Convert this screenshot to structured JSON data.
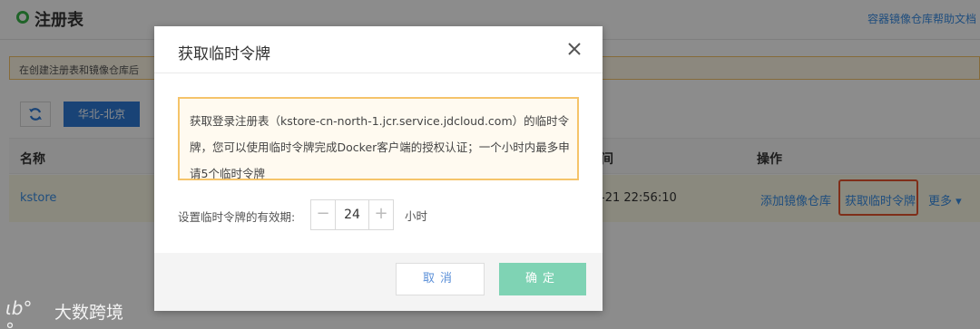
{
  "header": {
    "title": "注册表",
    "help_link": "容器镜像仓库帮助文档"
  },
  "notice": {
    "text": "在创建注册表和镜像仓库后"
  },
  "toolbar": {
    "refresh_icon": "refresh-icon",
    "region": "华北-北京"
  },
  "table": {
    "columns": [
      "名称",
      "间",
      "操作"
    ],
    "rows": [
      {
        "name": "kstore",
        "created": "-21 22:56:10",
        "actions": [
          "添加镜像仓库",
          "获取临时令牌",
          "更多"
        ]
      }
    ]
  },
  "modal": {
    "title": "获取临时令牌",
    "close_icon": "close-icon",
    "warning": "获取登录注册表（kstore-cn-north-1.jcr.service.jdcloud.com）的临时令牌，您可以使用临时令牌完成Docker客户端的授权认证；一个小时内最多申请5个临时令牌",
    "ttl_label": "设置临时令牌的有效期:",
    "ttl_minus": "−",
    "ttl_value": "24",
    "ttl_plus": "+",
    "ttl_unit": "小时",
    "cancel_label": "取消",
    "ok_label": "确定"
  },
  "watermark": {
    "logo": "ιb°°",
    "text": "大数跨境"
  },
  "colors": {
    "accent": "#3ab54a",
    "link": "#3a8ee6",
    "primary_button": "#7fd3b4",
    "highlight_border": "#e8542e",
    "warning_border": "#f5c46a"
  }
}
